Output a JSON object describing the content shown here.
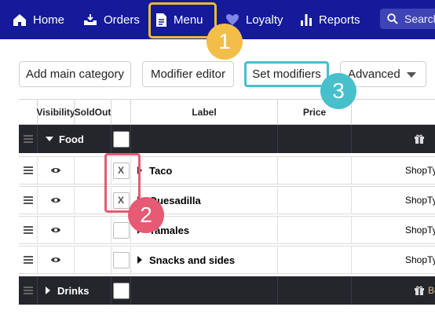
{
  "nav": {
    "items": [
      {
        "label": "Home",
        "icon": "home-icon"
      },
      {
        "label": "Orders",
        "icon": "tray-icon"
      },
      {
        "label": "Menu",
        "icon": "document-icon"
      },
      {
        "label": "Loyalty",
        "icon": "heart-icon"
      },
      {
        "label": "Reports",
        "icon": "bar-chart-icon"
      }
    ],
    "search_placeholder": "Search",
    "background": "#141a9a"
  },
  "badges": [
    "1",
    "2",
    "3"
  ],
  "toolbar": {
    "add_main_category": "Add main category",
    "modifier_editor": "Modifier editor",
    "set_modifiers": "Set modifiers",
    "advanced": "Advanced"
  },
  "table": {
    "headers": {
      "visibility": "Visibility",
      "soldout": "SoldOut",
      "label": "Label",
      "price": "Price"
    },
    "rows": [
      {
        "type": "category",
        "label": "Food",
        "expanded": true,
        "right_icon": "gift-icon"
      },
      {
        "type": "item",
        "label": "Taco",
        "soldout_mark": "X",
        "shop": "ShopType"
      },
      {
        "type": "item",
        "label": "Quesadilla",
        "soldout_mark": "X",
        "shop": "ShopType"
      },
      {
        "type": "item",
        "label": "Tamales",
        "soldout_mark": "",
        "shop": "ShopType"
      },
      {
        "type": "item",
        "label": "Snacks and sides",
        "soldout_mark": "",
        "shop": "ShopType",
        "expandable": true
      },
      {
        "type": "category",
        "label": "Drinks",
        "expanded": false,
        "right_icon": "gift-icon",
        "right_text": "Be"
      }
    ]
  },
  "colors": {
    "highlight_menu": "#f0b93a",
    "highlight_soldout": "#e65a74",
    "highlight_set_modifiers": "#47c0cc",
    "category_row": "#25262c"
  }
}
